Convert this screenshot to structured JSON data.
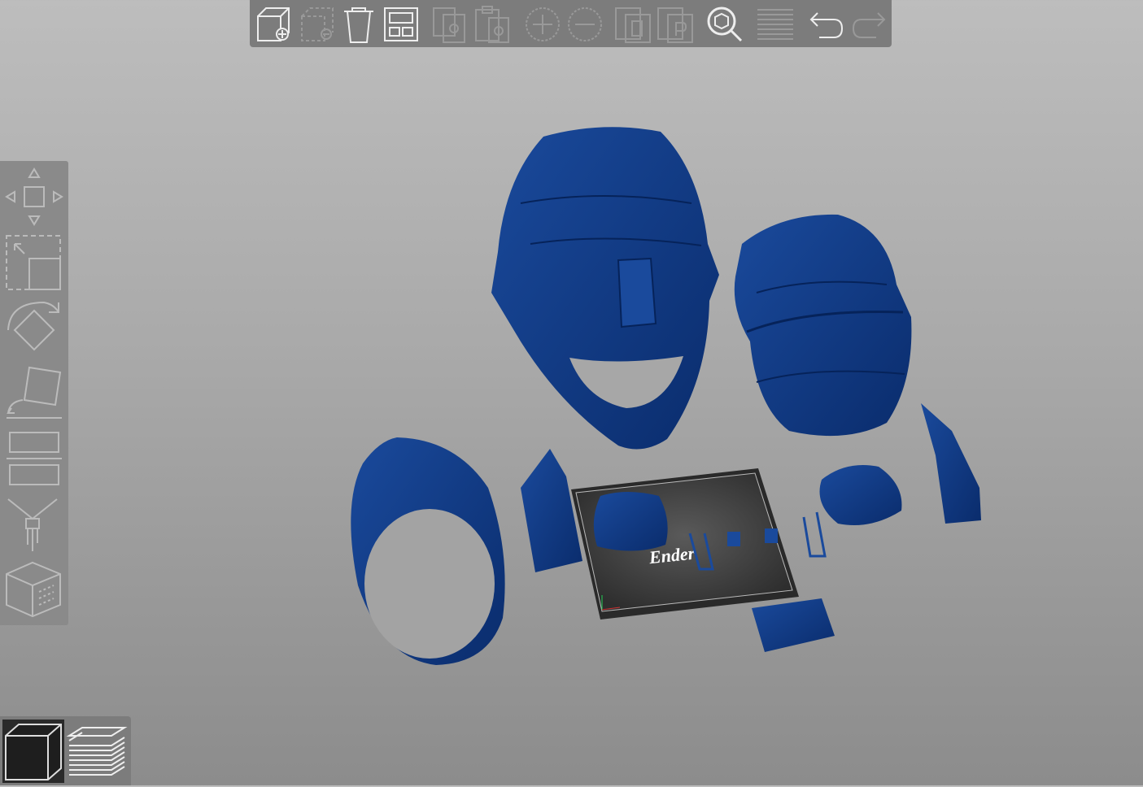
{
  "toolbar": {
    "buttons": [
      {
        "name": "add-model-button",
        "icon": "cube-plus-icon",
        "enabled": true
      },
      {
        "name": "remove-model-button",
        "icon": "cube-minus-icon",
        "enabled": false
      },
      {
        "name": "delete-button",
        "icon": "trash-icon",
        "enabled": true
      },
      {
        "name": "auto-arrange-button",
        "icon": "grid-layout-icon",
        "enabled": true
      },
      {
        "name": "copy-button",
        "icon": "copy-icon",
        "enabled": false
      },
      {
        "name": "paste-button",
        "icon": "paste-icon",
        "enabled": false
      },
      {
        "name": "add-instance-button",
        "icon": "plus-circle-icon",
        "enabled": false
      },
      {
        "name": "remove-instance-button",
        "icon": "minus-circle-icon",
        "enabled": false
      },
      {
        "name": "split-objects-button",
        "icon": "split-objects-icon",
        "enabled": false
      },
      {
        "name": "split-parts-button",
        "icon": "split-parts-icon",
        "enabled": false
      },
      {
        "name": "search-button",
        "icon": "search-icon",
        "enabled": true
      },
      {
        "name": "layer-editing-button",
        "icon": "layers-icon",
        "enabled": false
      },
      {
        "name": "undo-button",
        "icon": "undo-icon",
        "enabled": true
      },
      {
        "name": "redo-button",
        "icon": "redo-icon",
        "enabled": false
      }
    ]
  },
  "sidebar": {
    "tools": [
      {
        "name": "move-tool",
        "icon": "move-arrows-icon"
      },
      {
        "name": "scale-tool",
        "icon": "scale-icon"
      },
      {
        "name": "rotate-tool",
        "icon": "rotate-icon"
      },
      {
        "name": "place-on-face-tool",
        "icon": "place-on-face-icon"
      },
      {
        "name": "cut-tool",
        "icon": "cut-icon"
      },
      {
        "name": "paint-supports-tool",
        "icon": "brush-icon"
      },
      {
        "name": "variable-layer-tool",
        "icon": "cube-wireframe-icon"
      }
    ]
  },
  "view_switch": {
    "active": "3d-view",
    "buttons": [
      {
        "name": "3d-view-button",
        "icon": "cube-icon"
      },
      {
        "name": "preview-button",
        "icon": "layers-stack-icon"
      }
    ]
  },
  "bed": {
    "brand_label": "Ender"
  },
  "colors": {
    "model": "#0e3a86",
    "model_dark": "#082a66",
    "bed": "#3a3a3a",
    "accent_toolbar": "#7c7c7c"
  }
}
